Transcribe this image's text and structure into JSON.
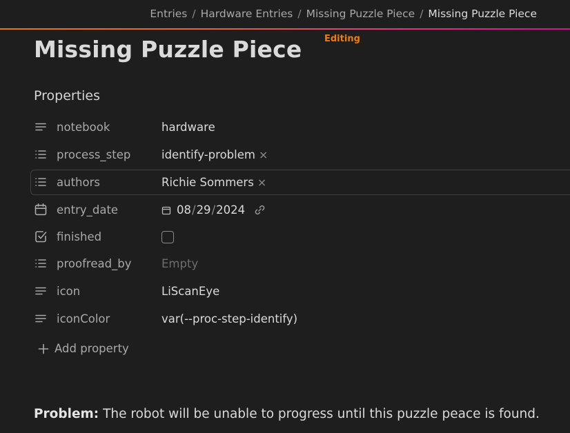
{
  "breadcrumb": [
    "Entries",
    "Hardware Entries",
    "Missing Puzzle Piece",
    "Missing Puzzle Piece"
  ],
  "breadcrumb_separator": "/",
  "page": {
    "title": "Missing Puzzle Piece",
    "status_badge": "Editing",
    "status_color": "#f07a14"
  },
  "properties": {
    "heading": "Properties",
    "rows": [
      {
        "key": "notebook",
        "icon": "text-lines-icon",
        "value": "hardware"
      },
      {
        "key": "process_step",
        "icon": "list-icon",
        "value": "identify-problem",
        "removable": true
      },
      {
        "key": "authors",
        "icon": "list-icon",
        "value": "Richie Sommers",
        "removable": true
      },
      {
        "key": "entry_date",
        "icon": "calendar-icon",
        "date": {
          "month": "08",
          "day": "29",
          "year": "2024"
        }
      },
      {
        "key": "finished",
        "icon": "checkbox-icon",
        "checked": false
      },
      {
        "key": "proofread_by",
        "icon": "list-icon",
        "placeholder": "Empty"
      },
      {
        "key": "icon",
        "icon": "text-lines-icon",
        "value": "LiScanEye"
      },
      {
        "key": "iconColor",
        "icon": "text-lines-icon",
        "value": "var(--proc-step-identify)"
      }
    ],
    "remove_glyph": "×",
    "add_label": "Add property"
  },
  "content": {
    "problem_label": "Problem:",
    "problem_text": " The robot will be unable to progress until this puzzle peace is found."
  }
}
